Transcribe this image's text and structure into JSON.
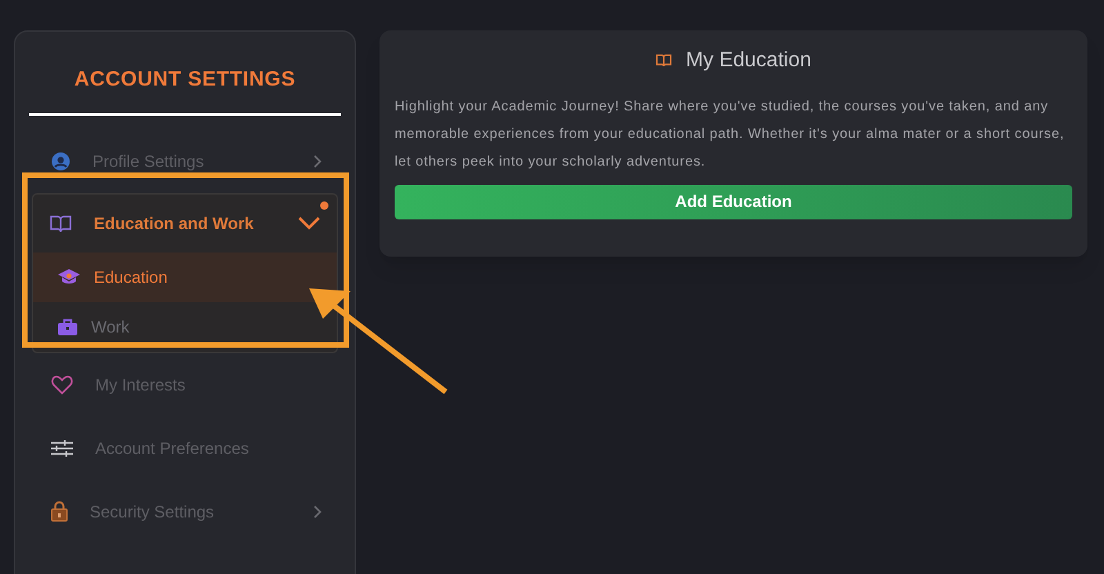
{
  "sidebar": {
    "title": "ACCOUNT SETTINGS",
    "items": [
      {
        "label": "Profile Settings",
        "kind": "profile",
        "chevron": true
      },
      {
        "label": "Education and Work",
        "kind": "book",
        "expanded": true,
        "notification": true,
        "children": [
          {
            "label": "Education",
            "kind": "cap",
            "selected": true
          },
          {
            "label": "Work",
            "kind": "briefcase",
            "selected": false
          }
        ]
      },
      {
        "label": "My Interests",
        "kind": "heart",
        "chevron": false
      },
      {
        "label": "Account Preferences",
        "kind": "sliders",
        "chevron": false
      },
      {
        "label": "Security Settings",
        "kind": "lock",
        "chevron": true
      }
    ]
  },
  "panel": {
    "title": "My Education",
    "description": "Highlight your Academic Journey! Share where you've studied, the courses you've taken, and any memorable experiences from your educational path. Whether it's your alma mater or a short course, let others peek into your scholarly adventures.",
    "button": "Add Education"
  }
}
